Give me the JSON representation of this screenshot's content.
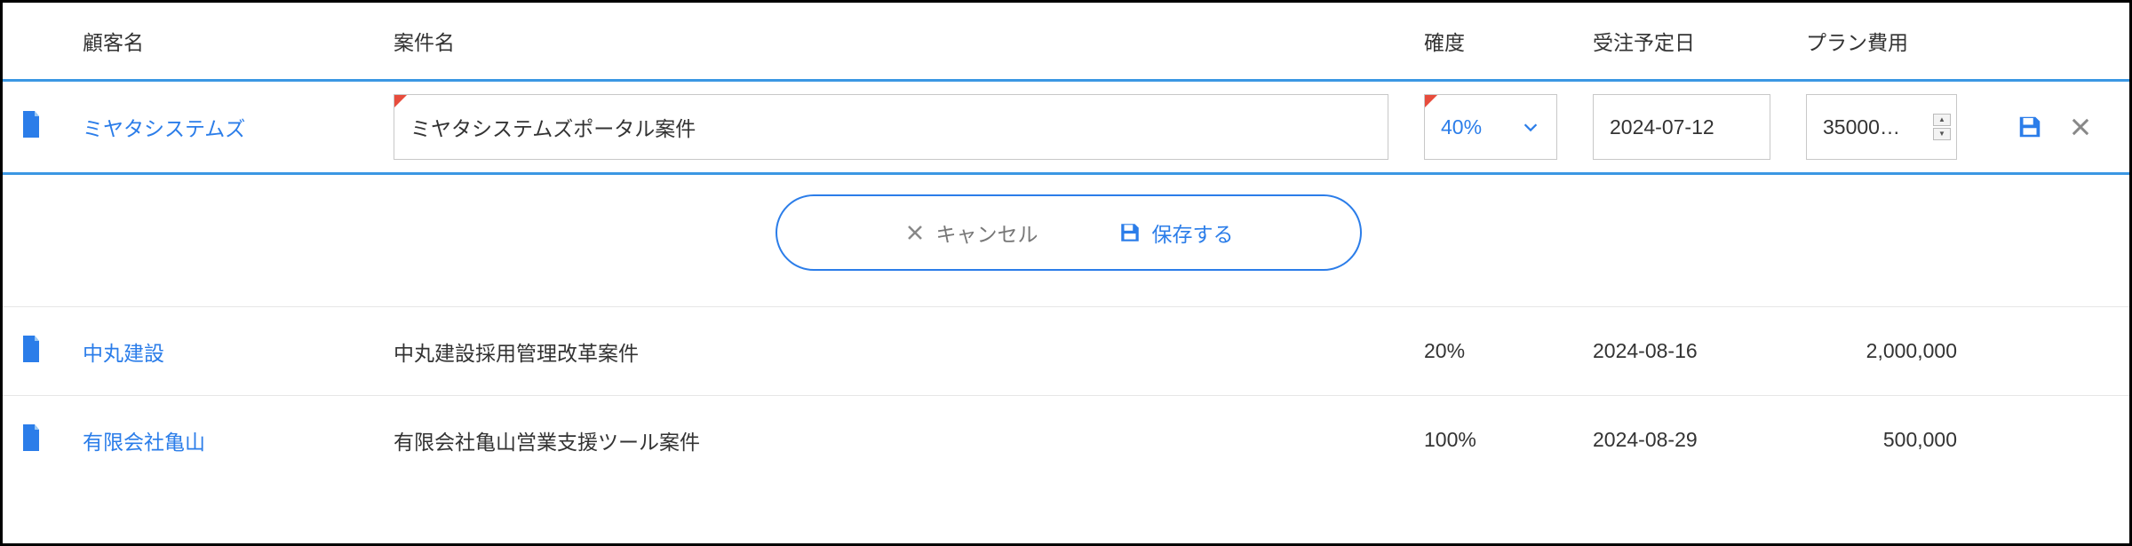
{
  "colors": {
    "accent": "#2b7de9",
    "danger": "#e74c3c"
  },
  "headers": {
    "customer": "顧客名",
    "project": "案件名",
    "probability": "確度",
    "expected_date": "受注予定日",
    "plan_cost": "プラン費用"
  },
  "edit_row": {
    "customer": "ミヤタシステムズ",
    "project": "ミヤタシステムズポータル案件",
    "probability": "40%",
    "expected_date": "2024-07-12",
    "plan_cost_display": "35000…"
  },
  "action_bar": {
    "cancel": "キャンセル",
    "save": "保存する"
  },
  "rows": [
    {
      "customer": "中丸建設",
      "project": "中丸建設採用管理改革案件",
      "probability": "20%",
      "expected_date": "2024-08-16",
      "plan_cost": "2,000,000"
    },
    {
      "customer": "有限会社亀山",
      "project": "有限会社亀山営業支援ツール案件",
      "probability": "100%",
      "expected_date": "2024-08-29",
      "plan_cost": "500,000"
    }
  ]
}
